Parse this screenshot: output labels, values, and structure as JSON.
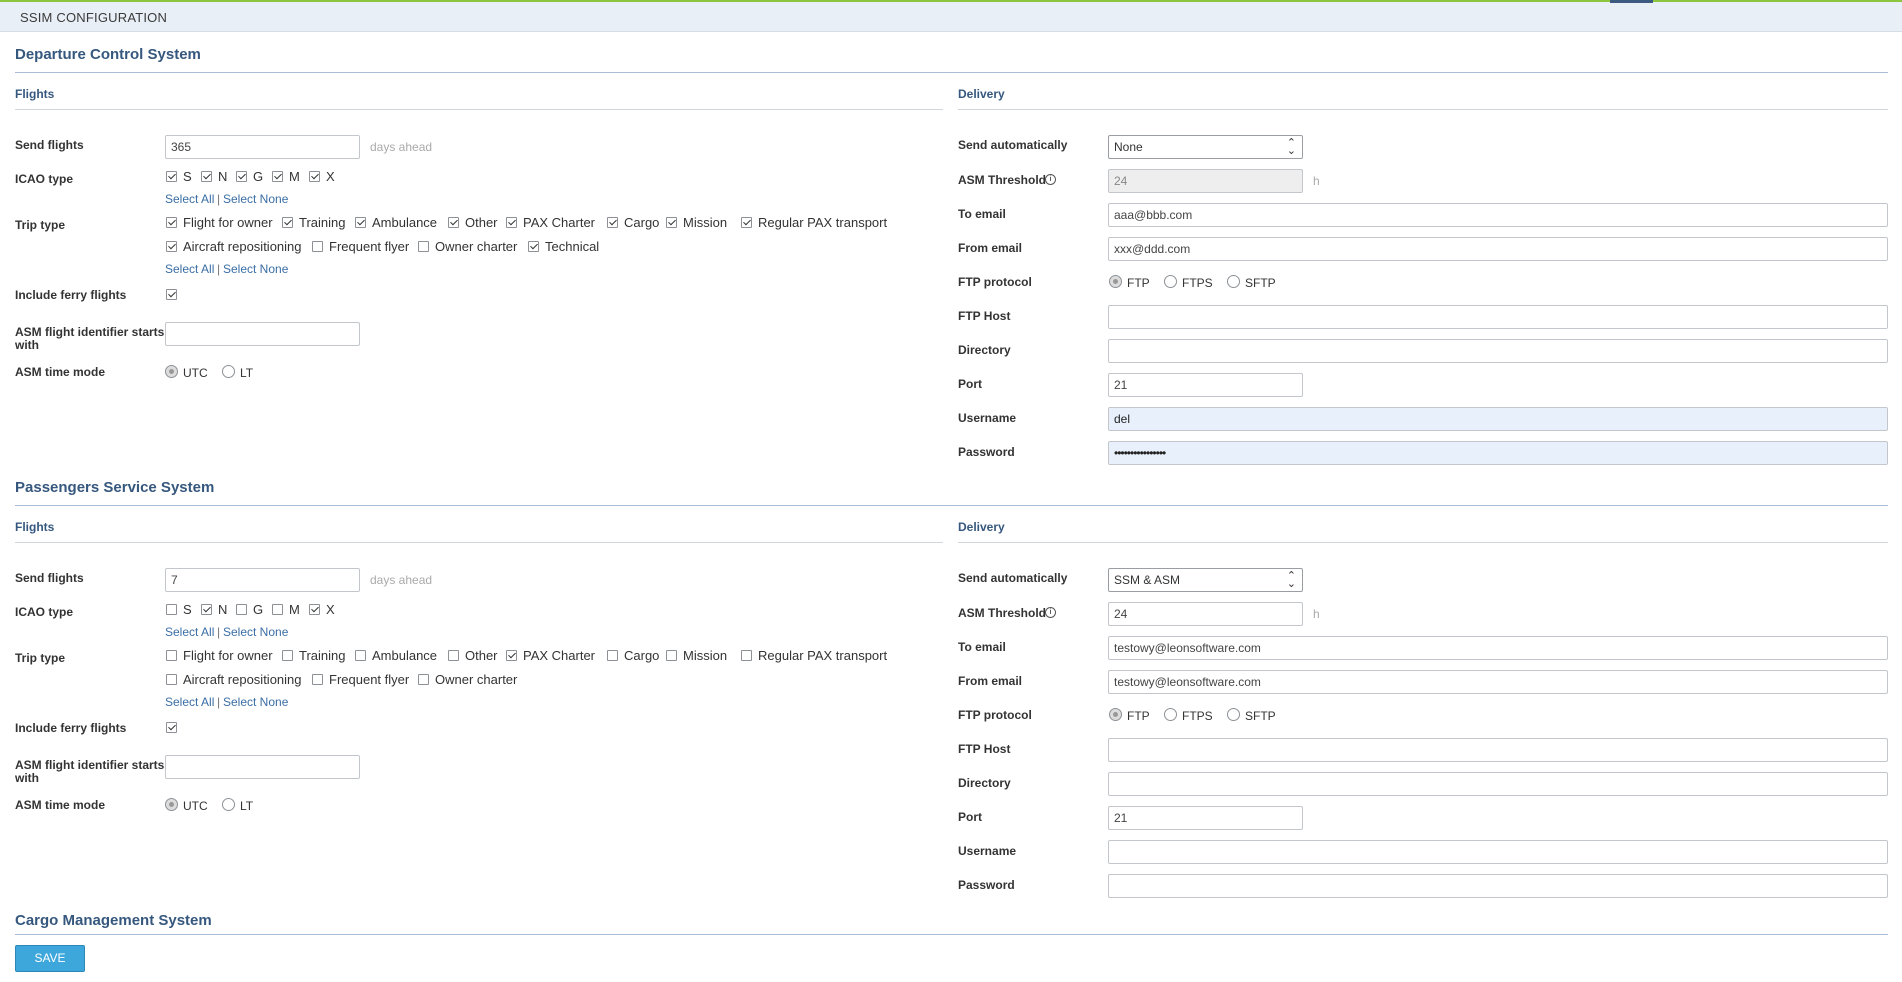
{
  "page": {
    "title": "SSIM CONFIGURATION"
  },
  "dcs": {
    "title": "Departure Control System",
    "flights": {
      "title": "Flights",
      "send_flights_label": "Send flights",
      "send_flights_value": "365",
      "days_ahead": "days ahead",
      "icao_label": "ICAO type",
      "icao": [
        {
          "label": "S",
          "checked": true
        },
        {
          "label": "N",
          "checked": true
        },
        {
          "label": "G",
          "checked": true
        },
        {
          "label": "M",
          "checked": true
        },
        {
          "label": "X",
          "checked": true
        }
      ],
      "select_all": "Select All",
      "separator": "|",
      "select_none": "Select None",
      "trip_label": "Trip type",
      "trip_row1": [
        {
          "label": "Flight for owner",
          "checked": true
        },
        {
          "label": "Training",
          "checked": true
        },
        {
          "label": "Ambulance",
          "checked": true
        },
        {
          "label": "Other",
          "checked": true
        },
        {
          "label": "PAX Charter",
          "checked": true
        },
        {
          "label": "Cargo",
          "checked": true
        },
        {
          "label": "Mission",
          "checked": true
        },
        {
          "label": "Regular PAX transport",
          "checked": true
        }
      ],
      "trip_row2": [
        {
          "label": "Aircraft repositioning",
          "checked": true
        },
        {
          "label": "Frequent flyer",
          "checked": false
        },
        {
          "label": "Owner charter",
          "checked": false
        },
        {
          "label": "Technical",
          "checked": true
        }
      ],
      "ferry_label": "Include ferry flights",
      "ferry_checked": true,
      "asm_ident_label_1": "ASM flight identifier starts",
      "asm_ident_label_2": "with",
      "asm_ident_value": "",
      "asm_time_label": "ASM time mode",
      "utc": "UTC",
      "lt": "LT"
    },
    "delivery": {
      "title": "Delivery",
      "send_auto_label": "Send automatically",
      "send_auto_value": "None",
      "asm_threshold_label": "ASM Threshold",
      "asm_threshold_value": "24",
      "h": "h",
      "to_email_label": "To email",
      "to_email_value": "aaa@bbb.com",
      "from_email_label": "From email",
      "from_email_value": "xxx@ddd.com",
      "ftp_protocol_label": "FTP protocol",
      "ftp": "FTP",
      "ftps": "FTPS",
      "sftp": "SFTP",
      "ftp_host_label": "FTP Host",
      "ftp_host_value": "",
      "directory_label": "Directory",
      "directory_value": "",
      "port_label": "Port",
      "port_value": "21",
      "username_label": "Username",
      "username_value": "del",
      "password_label": "Password",
      "password_value": "••••••••••••••••"
    }
  },
  "pss": {
    "title": "Passengers Service System",
    "flights": {
      "title": "Flights",
      "send_flights_label": "Send flights",
      "send_flights_value": "7",
      "days_ahead": "days ahead",
      "icao_label": "ICAO type",
      "icao": [
        {
          "label": "S",
          "checked": false
        },
        {
          "label": "N",
          "checked": true
        },
        {
          "label": "G",
          "checked": false
        },
        {
          "label": "M",
          "checked": false
        },
        {
          "label": "X",
          "checked": true
        }
      ],
      "select_all": "Select All",
      "separator": "|",
      "select_none": "Select None",
      "trip_label": "Trip type",
      "trip_row1": [
        {
          "label": "Flight for owner",
          "checked": false
        },
        {
          "label": "Training",
          "checked": false
        },
        {
          "label": "Ambulance",
          "checked": false
        },
        {
          "label": "Other",
          "checked": false
        },
        {
          "label": "PAX Charter",
          "checked": true
        },
        {
          "label": "Cargo",
          "checked": false
        },
        {
          "label": "Mission",
          "checked": false
        },
        {
          "label": "Regular PAX transport",
          "checked": false
        }
      ],
      "trip_row2": [
        {
          "label": "Aircraft repositioning",
          "checked": false
        },
        {
          "label": "Frequent flyer",
          "checked": false
        },
        {
          "label": "Owner charter",
          "checked": false
        }
      ],
      "ferry_label": "Include ferry flights",
      "ferry_checked": true,
      "asm_ident_label_1": "ASM flight identifier starts",
      "asm_ident_label_2": "with",
      "asm_ident_value": "",
      "asm_time_label": "ASM time mode",
      "utc": "UTC",
      "lt": "LT"
    },
    "delivery": {
      "title": "Delivery",
      "send_auto_label": "Send automatically",
      "send_auto_value": "SSM & ASM",
      "asm_threshold_label": "ASM Threshold",
      "asm_threshold_value": "24",
      "h": "h",
      "to_email_label": "To email",
      "to_email_value": "testowy@leonsoftware.com",
      "from_email_label": "From email",
      "from_email_value": "testowy@leonsoftware.com",
      "ftp_protocol_label": "FTP protocol",
      "ftp": "FTP",
      "ftps": "FTPS",
      "sftp": "SFTP",
      "ftp_host_label": "FTP Host",
      "ftp_host_value": "",
      "directory_label": "Directory",
      "directory_value": "",
      "port_label": "Port",
      "port_value": "21",
      "username_label": "Username",
      "username_value": "",
      "password_label": "Password",
      "password_value": ""
    }
  },
  "cms": {
    "title": "Cargo Management System"
  },
  "save_label": "SAVE",
  "icons": {
    "info": "info-icon",
    "select": "chevron-updown-icon",
    "checkbox": "check-icon"
  }
}
